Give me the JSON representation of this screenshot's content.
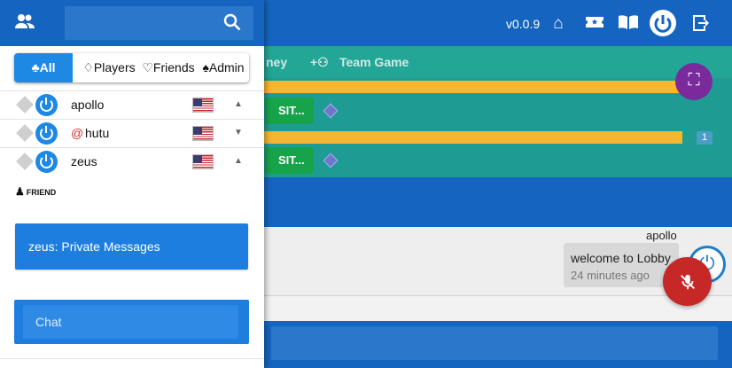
{
  "app": {
    "version": "v0.0.9",
    "header_icons": [
      "home-icon",
      "ticket-icon",
      "book-icon",
      "power-icon",
      "logout-icon"
    ],
    "tabs": [
      {
        "label": "ney"
      },
      {
        "label": "Team Game"
      }
    ],
    "sit_label": "SIT...",
    "player_count_badge": "1"
  },
  "drawer": {
    "search": {
      "placeholder": ""
    },
    "filters": [
      {
        "label": "♣All",
        "active": true
      },
      {
        "label": "♢Players"
      },
      {
        "label": "♡Friends"
      },
      {
        "label": "♠Admin"
      }
    ],
    "users": [
      {
        "name": "apollo",
        "mention": "",
        "flag": "US",
        "expanded": true
      },
      {
        "name": "hutu",
        "mention": "@",
        "flag": "US",
        "expanded": false
      },
      {
        "name": "zeus",
        "mention": "",
        "flag": "US",
        "expanded": true
      }
    ],
    "friend_tag": "FRIEND",
    "private_messages_label": "zeus: Private Messages",
    "chat_placeholder": "Chat"
  },
  "chat": {
    "messages": [
      {
        "author": "apollo",
        "text": "welcome to Lobby",
        "time": "24 minutes ago"
      }
    ]
  },
  "colors": {
    "primary": "#1565c0",
    "teal": "#23a695",
    "accent_blue": "#1e88e5",
    "gold": "#f5b731",
    "green": "#16a34a",
    "purple": "#7b2a9c",
    "red": "#c62828"
  }
}
